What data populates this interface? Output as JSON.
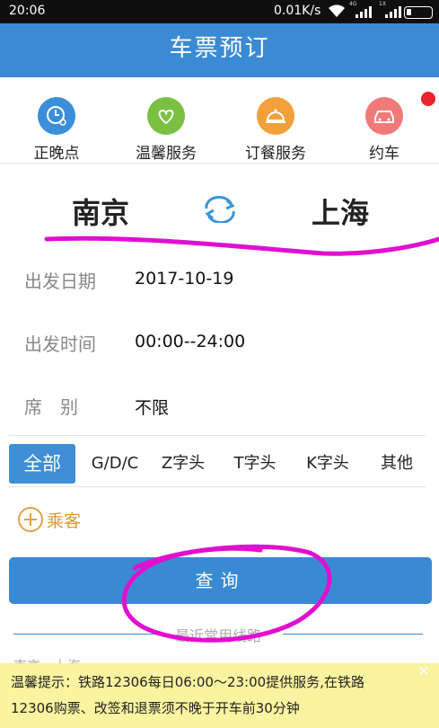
{
  "status_bar": {
    "time": "20:06",
    "speed": "0.01K/s",
    "signal1_label": "4G",
    "signal2_label": "1X"
  },
  "app": {
    "title": "车票预订"
  },
  "services": [
    {
      "label": "正晚点",
      "icon": "clock-icon",
      "color": "#3b8fd8"
    },
    {
      "label": "温馨服务",
      "icon": "heart-hands-icon",
      "color": "#7bc043"
    },
    {
      "label": "订餐服务",
      "icon": "cloche-icon",
      "color": "#f2a03a"
    },
    {
      "label": "约车",
      "icon": "car-icon",
      "color": "#f07a7a",
      "badge": true
    }
  ],
  "route": {
    "from": "南京",
    "to": "上海"
  },
  "form": {
    "date_label": "出发日期",
    "date_value": "2017-10-19",
    "time_label": "出发时间",
    "time_value": "00:00--24:00",
    "seat_label": "席　别",
    "seat_value": "不限"
  },
  "train_types": {
    "all": "全部",
    "gdc": "G/D/C",
    "z": "Z字头",
    "t": "T字头",
    "k": "K字头",
    "other": "其他",
    "selected": "全部"
  },
  "passenger": {
    "label": "乘客"
  },
  "query": {
    "label": "查询"
  },
  "recent": {
    "title": "最近常用线路",
    "item": "南京 - 上海"
  },
  "notice": {
    "line1": "温馨提示：铁路12306每日06:00～23:00提供服务,在铁路",
    "line2": "12306购票、改签和退票须不晚于开车前30分钟"
  },
  "colors": {
    "primary": "#3b8ad4",
    "notice_bg": "#faf3a0",
    "passenger": "#e09a30",
    "annotation": "#e010d0"
  }
}
